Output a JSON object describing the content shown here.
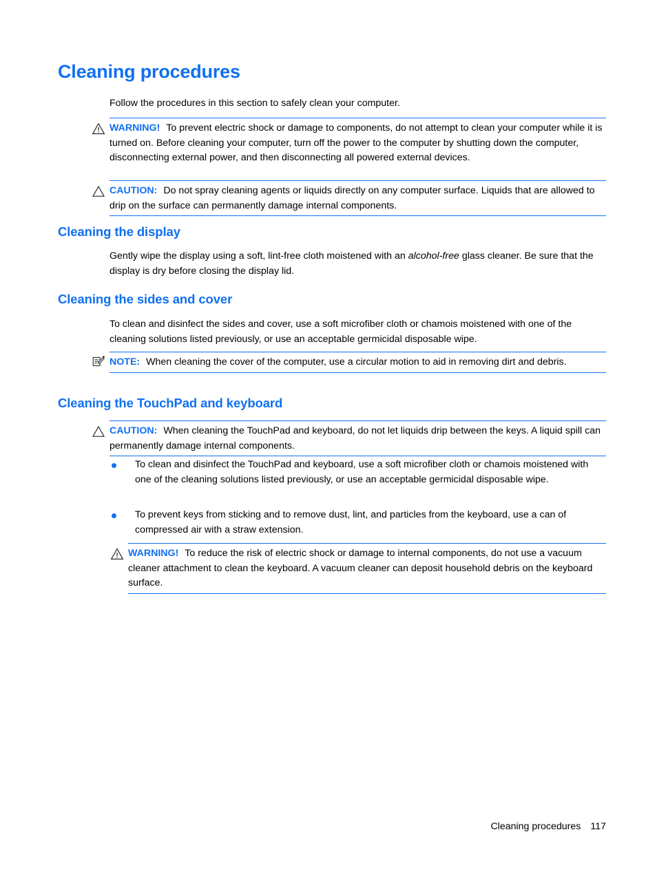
{
  "page": {
    "title": "Cleaning procedures",
    "intro": "Follow the procedures in this section to safely clean your computer.",
    "accent_color": "#1070f0",
    "text_color": "#000000",
    "background_color": "#ffffff"
  },
  "admonitions": {
    "warning_top": {
      "icon": "warning-triangle-icon",
      "label": "WARNING!",
      "text": "To prevent electric shock or damage to components, do not attempt to clean your computer while it is turned on. Before cleaning your computer, turn off the power to the computer by shutting down the computer, disconnecting external power, and then disconnecting all powered external devices."
    },
    "caution_top": {
      "icon": "caution-triangle-icon",
      "label": "CAUTION:",
      "text": "Do not spray cleaning agents or liquids directly on any computer surface. Liquids that are allowed to drip on the surface can permanently damage internal components."
    },
    "note_cover": {
      "icon": "note-icon",
      "label": "NOTE:",
      "text": "When cleaning the cover of the computer, use a circular motion to aid in removing dirt and debris."
    },
    "caution_touchpad": {
      "icon": "caution-triangle-icon",
      "label": "CAUTION:",
      "text": "When cleaning the TouchPad and keyboard, do not let liquids drip between the keys. A liquid spill can permanently damage internal components."
    },
    "warning_vacuum": {
      "icon": "warning-triangle-icon",
      "label": "WARNING!",
      "text": "To reduce the risk of electric shock or damage to internal components, do not use a vacuum cleaner attachment to clean the keyboard. A vacuum cleaner can deposit household debris on the keyboard surface."
    }
  },
  "sections": {
    "display": {
      "heading": "Cleaning the display",
      "body_before_italic": "Gently wipe the display using a soft, lint-free cloth moistened with an ",
      "italic_phrase": "alcohol-free",
      "body_after_italic": " glass cleaner. Be sure that the display is dry before closing the display lid."
    },
    "sides_cover": {
      "heading": "Cleaning the sides and cover",
      "body": "To clean and disinfect the sides and cover, use a soft microfiber cloth or chamois moistened with one of the cleaning solutions listed previously, or use an acceptable germicidal disposable wipe."
    },
    "touchpad_keyboard": {
      "heading": "Cleaning the TouchPad and keyboard",
      "bullets": [
        "To clean and disinfect the TouchPad and keyboard, use a soft microfiber cloth or chamois moistened with one of the cleaning solutions listed previously, or use an acceptable germicidal disposable wipe.",
        "To prevent keys from sticking and to remove dust, lint, and particles from the keyboard, use a can of compressed air with a straw extension."
      ]
    }
  },
  "footer": {
    "section_label": "Cleaning procedures",
    "page_number": "117"
  }
}
